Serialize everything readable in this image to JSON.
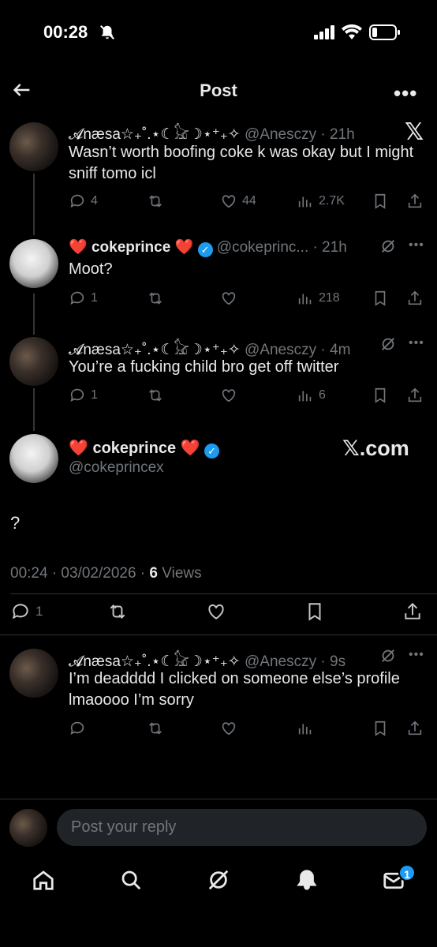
{
  "status_bar": {
    "time": "00:28"
  },
  "header": {
    "title": "Post"
  },
  "tweets": [
    {
      "display_name": "𝓐næsa☆₊˚.⋆☾𓃠☽⋆⁺₊✧",
      "handle": "@Anesczy",
      "time": "21h",
      "text": "Wasn’t worth boofing coke k was okay but I might sniff tomo icl",
      "replies": "4",
      "likes": "44",
      "views": "2.7K"
    },
    {
      "display_name": "cokeprince",
      "handle": "@cokeprinc...",
      "time": "21h",
      "text": "Moot?",
      "replies": "1",
      "views": "218"
    },
    {
      "display_name": "𝓐næsa☆₊˚.⋆☾𓃠☽⋆⁺₊✧",
      "handle": "@Anesczy",
      "time": "4m",
      "text": "You’re a fucking child bro get off twitter",
      "replies": "1",
      "views": "6"
    }
  ],
  "main_post": {
    "display_name": "cokeprince",
    "handle": "@cokeprincex",
    "watermark": "𝕏.com",
    "text": "?",
    "timestamp": "00:24 · 03/02/2026 ·",
    "views_count": "6",
    "views_label": "Views",
    "replies": "1"
  },
  "reply": {
    "display_name": "𝓐næsa☆₊˚.⋆☾𓃠☽⋆⁺₊✧",
    "handle": "@Anesczy",
    "time": "9s",
    "text": "I’m deadddd I clicked on someone else’s profile lmaoooo I’m sorry"
  },
  "composer": {
    "placeholder": "Post your reply"
  },
  "bottom_nav": {
    "messages_badge": "1"
  },
  "colors": {
    "accent": "#1d9bf0",
    "heart": "#e0245e",
    "background": "#000000"
  }
}
